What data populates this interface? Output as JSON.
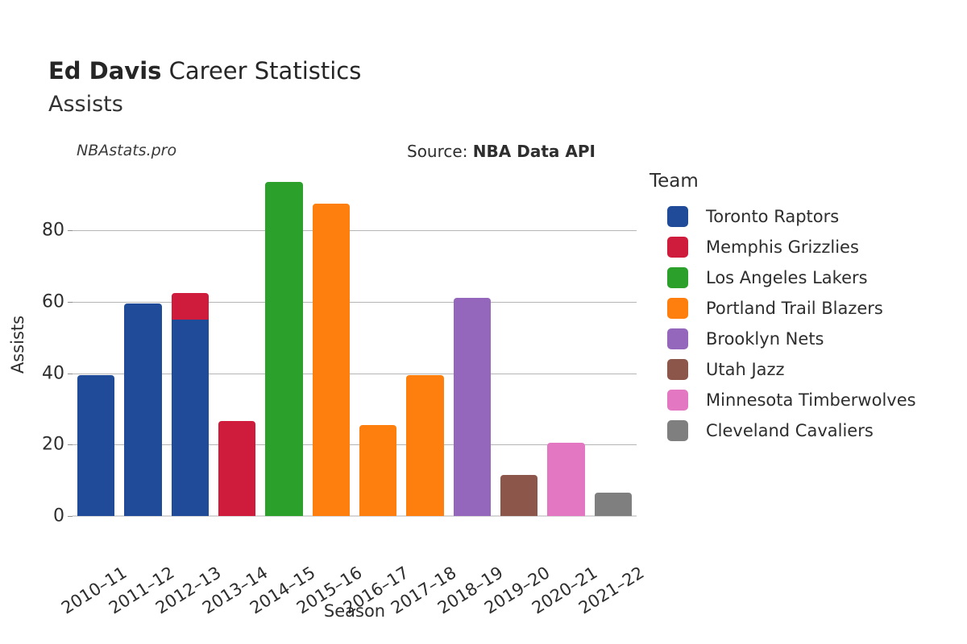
{
  "header": {
    "title_bold": "Ed Davis",
    "title_regular": " Career Statistics",
    "subtitle": "Assists",
    "watermark": "NBAstats.pro",
    "source_label": "Source: ",
    "source_value": "NBA Data API"
  },
  "legend": {
    "title": "Team",
    "items": [
      {
        "label": "Toronto Raptors",
        "color": "#1f4b99"
      },
      {
        "label": "Memphis Grizzlies",
        "color": "#d01c3c"
      },
      {
        "label": "Los Angeles Lakers",
        "color": "#2ba02b"
      },
      {
        "label": "Portland Trail Blazers",
        "color": "#ff7f0e"
      },
      {
        "label": "Brooklyn Nets",
        "color": "#9467bd"
      },
      {
        "label": "Utah Jazz",
        "color": "#8c564b"
      },
      {
        "label": "Minnesota Timberwolves",
        "color": "#e377c2"
      },
      {
        "label": "Cleveland Cavaliers",
        "color": "#7f7f7f"
      }
    ]
  },
  "chart_data": {
    "type": "bar",
    "title": "Ed Davis Career Statistics",
    "subtitle": "Assists",
    "xlabel": "Season",
    "ylabel": "Assists",
    "ylim": [
      0,
      96
    ],
    "yticks": [
      0,
      20,
      40,
      60,
      80
    ],
    "grid": true,
    "legend_position": "right",
    "stacked": true,
    "categories": [
      "2010–11",
      "2011–12",
      "2012–13",
      "2013–14",
      "2014–15",
      "2015–16",
      "2016–17",
      "2017–18",
      "2018–19",
      "2019–20",
      "2020–21",
      "2021–22"
    ],
    "bars": [
      {
        "season": "2010–11",
        "total": 39.5,
        "segments": [
          {
            "team": "Toronto Raptors",
            "value": 39.5,
            "color": "#1f4b99"
          }
        ]
      },
      {
        "season": "2011–12",
        "total": 59.5,
        "segments": [
          {
            "team": "Toronto Raptors",
            "value": 59.5,
            "color": "#1f4b99"
          }
        ]
      },
      {
        "season": "2012–13",
        "total": 62.5,
        "segments": [
          {
            "team": "Toronto Raptors",
            "value": 55.0,
            "color": "#1f4b99"
          },
          {
            "team": "Memphis Grizzlies",
            "value": 7.5,
            "color": "#d01c3c"
          }
        ]
      },
      {
        "season": "2013–14",
        "total": 26.5,
        "segments": [
          {
            "team": "Memphis Grizzlies",
            "value": 26.5,
            "color": "#d01c3c"
          }
        ]
      },
      {
        "season": "2014–15",
        "total": 93.5,
        "segments": [
          {
            "team": "Los Angeles Lakers",
            "value": 93.5,
            "color": "#2ba02b"
          }
        ]
      },
      {
        "season": "2015–16",
        "total": 87.5,
        "segments": [
          {
            "team": "Portland Trail Blazers",
            "value": 87.5,
            "color": "#ff7f0e"
          }
        ]
      },
      {
        "season": "2016–17",
        "total": 25.5,
        "segments": [
          {
            "team": "Portland Trail Blazers",
            "value": 25.5,
            "color": "#ff7f0e"
          }
        ]
      },
      {
        "season": "2017–18",
        "total": 39.5,
        "segments": [
          {
            "team": "Portland Trail Blazers",
            "value": 39.5,
            "color": "#ff7f0e"
          }
        ]
      },
      {
        "season": "2018–19",
        "total": 61.0,
        "segments": [
          {
            "team": "Brooklyn Nets",
            "value": 61.0,
            "color": "#9467bd"
          }
        ]
      },
      {
        "season": "2019–20",
        "total": 11.5,
        "segments": [
          {
            "team": "Utah Jazz",
            "value": 11.5,
            "color": "#8c564b"
          }
        ]
      },
      {
        "season": "2020–21",
        "total": 20.5,
        "segments": [
          {
            "team": "Minnesota Timberwolves",
            "value": 20.5,
            "color": "#e377c2"
          }
        ]
      },
      {
        "season": "2021–22",
        "total": 6.5,
        "segments": [
          {
            "team": "Cleveland Cavaliers",
            "value": 6.5,
            "color": "#7f7f7f"
          }
        ]
      }
    ]
  }
}
